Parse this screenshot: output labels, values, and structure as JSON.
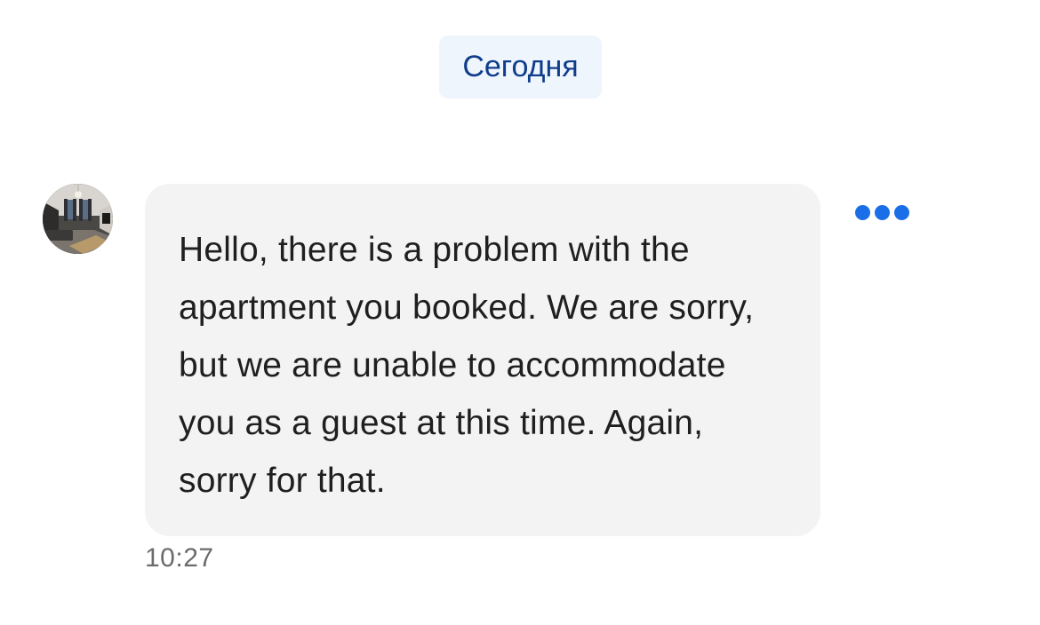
{
  "chat": {
    "date_label": "Сегодня",
    "message": {
      "text": "Hello, there is a problem with the apartment you booked. We are sorry, but we are unable to accommodate you as a guest at this time. Again, sorry for that.",
      "time": "10:27"
    },
    "sender_avatar": {
      "icon": "apartment-photo"
    },
    "actions": {
      "icon": "more-horizontal-icon",
      "accent_color": "#1a6ee8"
    }
  },
  "colors": {
    "background": "#ffffff",
    "bubble": "#f3f3f3",
    "date_chip_bg": "#eef5fd",
    "date_chip_text": "#0f3d8a",
    "timestamp": "#6b6b6b"
  }
}
